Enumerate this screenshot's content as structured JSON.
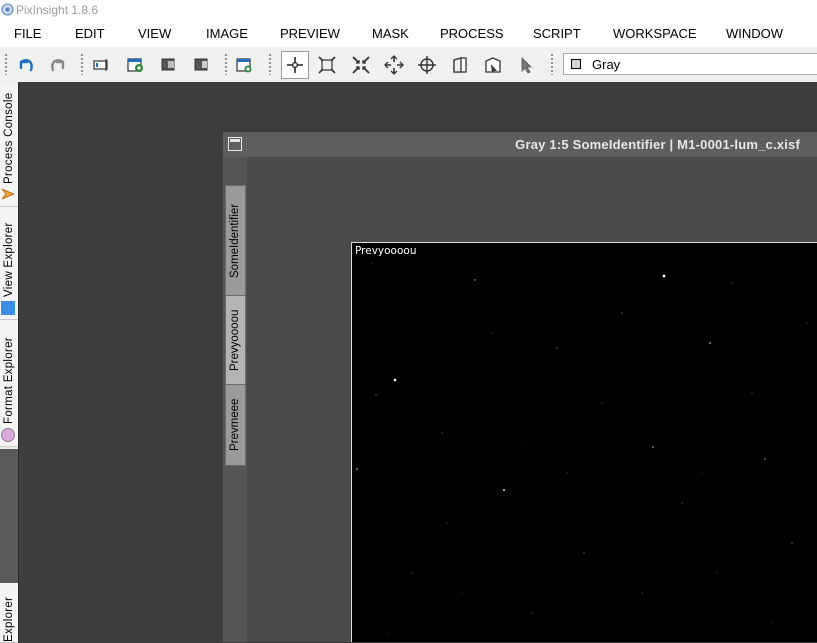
{
  "window": {
    "title": "PixInsight 1.8.6"
  },
  "menu": [
    "FILE",
    "EDIT",
    "VIEW",
    "IMAGE",
    "PREVIEW",
    "MASK",
    "PROCESS",
    "SCRIPT",
    "WORKSPACE",
    "WINDOW"
  ],
  "toolbar": {
    "view_selector_value": "Gray",
    "buttons": [
      "undo-icon",
      "redo-icon",
      "identifier-icon",
      "new-image-icon",
      "clone-icon",
      "duplicate-icon",
      "new-preview-icon",
      "readout-mode-icon",
      "zoom-fit-icon",
      "zoom-in-icon",
      "zoom-out-icon",
      "pan-icon",
      "crop-icon",
      "mask-icon",
      "pointer-icon"
    ]
  },
  "side_panel": {
    "tabs": [
      {
        "label": "Process Console",
        "icon": "process-console-icon"
      },
      {
        "label": "View Explorer",
        "icon": "view-explorer-icon"
      },
      {
        "label": "Format Explorer",
        "icon": "format-explorer-icon"
      },
      {
        "label": "Explorer",
        "icon": ""
      }
    ]
  },
  "image_window": {
    "title": "Gray 1:5 SomeIdentifier | M1-0001-lum_c.xisf",
    "tabs": [
      "SomeIdentifier",
      "Prevyoooou",
      "Prevmeee"
    ],
    "preview_label": "Prevyoooou"
  },
  "colors": {
    "accent": "#1f6fc1",
    "workspace": "#3d3d3d",
    "window": "#5a5a5a"
  }
}
